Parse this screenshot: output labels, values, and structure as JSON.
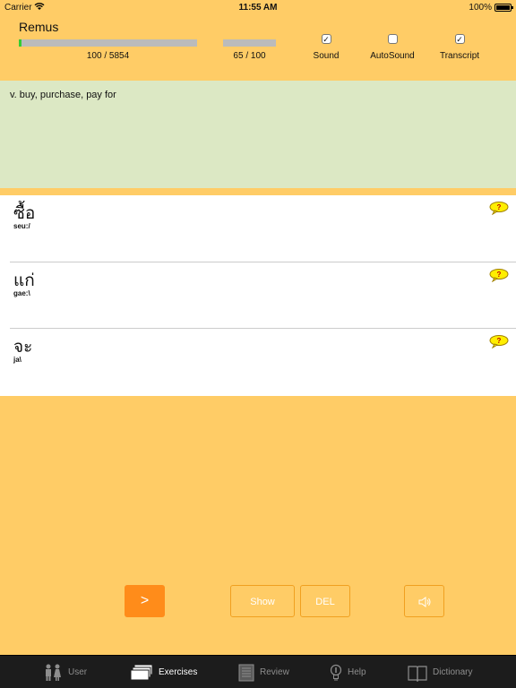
{
  "status": {
    "carrier": "Carrier",
    "time": "11:55 AM",
    "battery": "100%"
  },
  "header": {
    "username": "Remus",
    "total_progress": {
      "text": "100 / 5854",
      "fraction": 0.017
    },
    "session_progress": {
      "text": "65 / 100",
      "fraction": 0.0
    },
    "options": [
      {
        "label": "Sound",
        "checked": true
      },
      {
        "label": "AutoSound",
        "checked": false
      },
      {
        "label": "Transcript",
        "checked": true
      }
    ]
  },
  "meaning": "v. buy, purchase, pay for",
  "answers": [
    {
      "thai": "ซื้อ",
      "roman": "seu:/"
    },
    {
      "thai": "แก่",
      "roman": "gae:\\"
    },
    {
      "thai": "จะ",
      "roman": "ja\\"
    }
  ],
  "buttons": {
    "next": ">",
    "show": "Show",
    "del": "DEL"
  },
  "tabs": [
    {
      "label": "User",
      "icon": "user-icon",
      "active": false
    },
    {
      "label": "Exercises",
      "icon": "cards-icon",
      "active": true
    },
    {
      "label": "Review",
      "icon": "notepad-icon",
      "active": false
    },
    {
      "label": "Help",
      "icon": "lightbulb-icon",
      "active": false
    },
    {
      "label": "Dictionary",
      "icon": "book-icon",
      "active": false
    }
  ],
  "colors": {
    "background": "#FFCC66",
    "meaning_panel": "#DCE8C4",
    "next_button": "#FF8C1A",
    "progress_fill": "#33CC33",
    "tabbar": "#1C1C1C"
  }
}
